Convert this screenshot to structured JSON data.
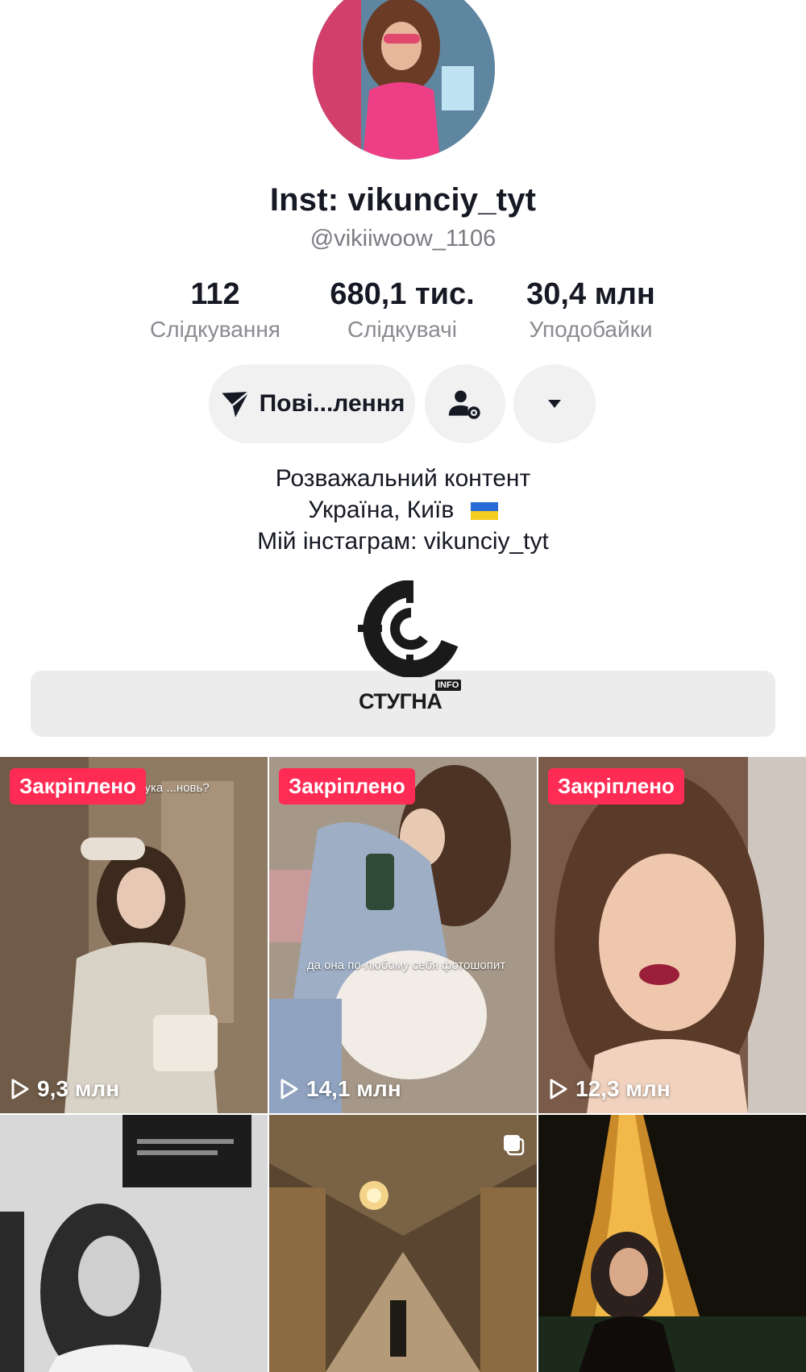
{
  "profile": {
    "display_name": "Inst: vikunciy_tyt",
    "username": "@vikiiwoow_1106"
  },
  "stats": [
    {
      "value": "112",
      "label": "Слідкування"
    },
    {
      "value": "680,1 тис.",
      "label": "Слідкувачі"
    },
    {
      "value": "30,4 млн",
      "label": "Уподобайки"
    }
  ],
  "actions": {
    "message_label": "Пові...лення",
    "message_icon": "send-icon",
    "add_friend_icon": "user-gear-icon",
    "more_icon": "caret-down-icon"
  },
  "bio": {
    "line1": "Розважальний контент",
    "line2": "Україна, Київ",
    "line2_flag": "ukraine-flag-icon",
    "line3": "Мій інстаграм: vikunciy_tyt"
  },
  "watermark": {
    "text": "СТУГНА",
    "sup": "INFO"
  },
  "videos": [
    {
      "pinned_label": "Закріплено",
      "views": "9,3 млн",
      "caption": "...кука ...новь?"
    },
    {
      "pinned_label": "Закріплено",
      "views": "14,1 млн",
      "caption": "да она по-любому себя фотошопит"
    },
    {
      "pinned_label": "Закріплено",
      "views": "12,3 млн",
      "caption": ""
    },
    {
      "pinned_label": "",
      "views": "",
      "caption": ""
    },
    {
      "pinned_label": "",
      "views": "",
      "caption": ""
    },
    {
      "pinned_label": "",
      "views": "",
      "caption": ""
    }
  ],
  "colors": {
    "accent": "#fe2c55",
    "muted_text": "#8a8b91",
    "button_bg": "#f1f1f2"
  }
}
